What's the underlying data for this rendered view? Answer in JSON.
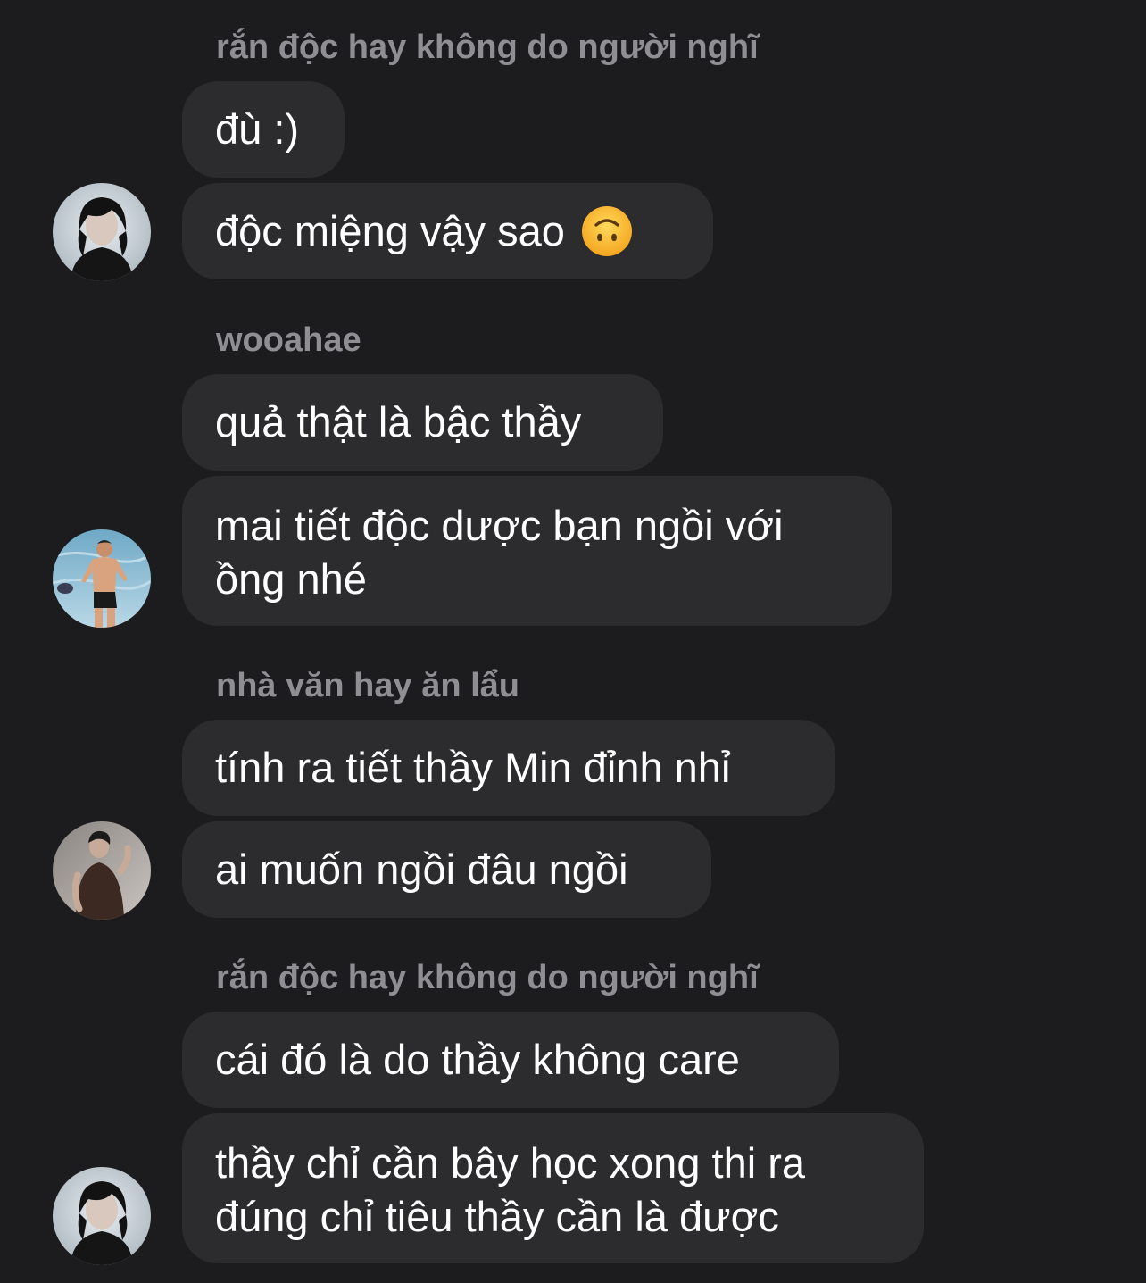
{
  "messages": [
    {
      "sender": "rắn độc hay không do người nghĩ",
      "bubbles": [
        "đù :)",
        "độc miệng vậy sao"
      ],
      "emoji": "upside-down-face-emoji",
      "avatar": "avatar-dark-hair-portrait"
    },
    {
      "sender": "wooahae",
      "bubbles": [
        "quả thật là bậc thầy",
        "mai tiết độc dược bạn ngồi với ồng nhé"
      ],
      "avatar": "avatar-beach-photo"
    },
    {
      "sender": "nhà văn hay ăn lẩu",
      "bubbles": [
        "tính ra tiết thầy Min đỉnh nhỉ",
        "ai muốn ngồi đâu ngồi"
      ],
      "avatar": "avatar-brown-shirt-photo"
    },
    {
      "sender": "rắn độc hay không do người nghĩ",
      "bubbles": [
        "cái đó là do thầy không care",
        "thầy chỉ cần bây học xong thi ra đúng chỉ tiêu thầy cần là được"
      ],
      "avatar": "avatar-dark-hair-portrait"
    }
  ],
  "colors": {
    "background": "#1c1c1e",
    "bubble": "#2c2c2e",
    "sender_text": "#8e8e93",
    "message_text": "#ffffff"
  }
}
